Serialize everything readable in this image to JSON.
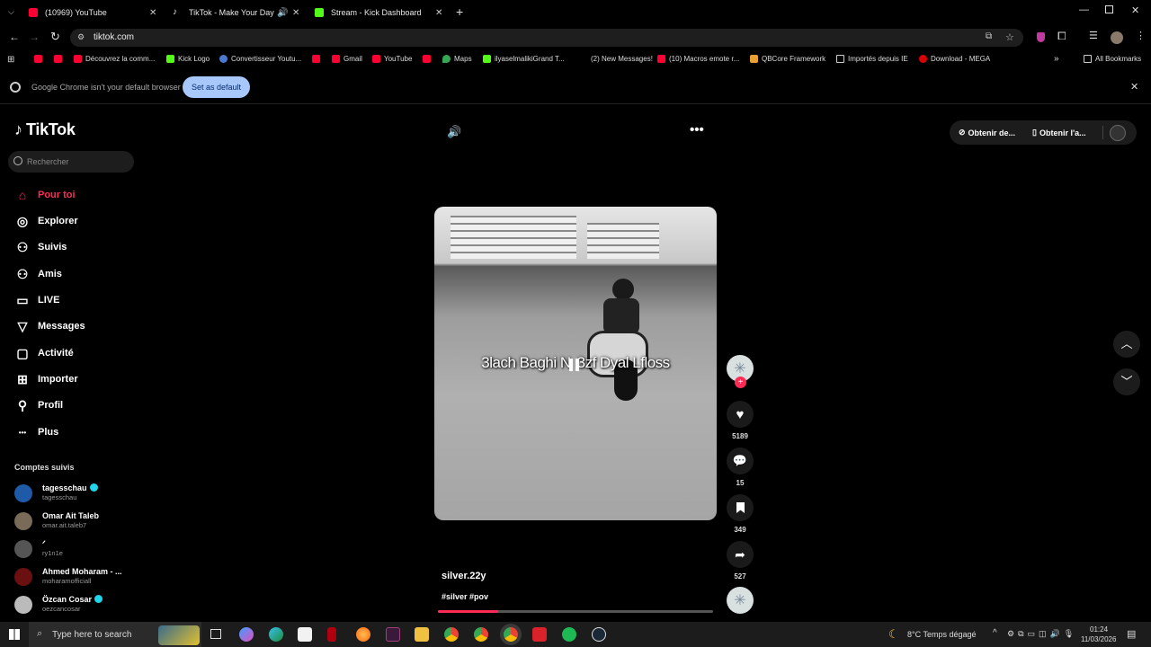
{
  "browser": {
    "tabs": [
      {
        "title": "(10969) YouTube"
      },
      {
        "title": "TikTok - Make Your Day"
      },
      {
        "title": "Stream - Kick Dashboard"
      }
    ],
    "url": "tiktok.com",
    "bookmarks": [
      {
        "label": "Découvrez la comm..."
      },
      {
        "label": "Kick Logo"
      },
      {
        "label": "Convertisseur Youtu..."
      },
      {
        "label": "Gmail"
      },
      {
        "label": "YouTube"
      },
      {
        "label": "Maps"
      },
      {
        "label": "ilyaselmalikiGrand T..."
      },
      {
        "label": "(2) New Messages!"
      },
      {
        "label": "(10) Macros emote r..."
      },
      {
        "label": "QBCore Framework"
      },
      {
        "label": "Importés depuis IE"
      },
      {
        "label": "Download - MEGA"
      }
    ],
    "all_bookmarks": "All Bookmarks",
    "infobar_text": "Google Chrome isn't your default browser",
    "infobar_button": "Set as default"
  },
  "tiktok": {
    "logo": "TikTok",
    "search_placeholder": "Rechercher",
    "nav": [
      {
        "label": "Pour toi",
        "icon": "home-icon",
        "active": true
      },
      {
        "label": "Explorer",
        "icon": "compass-icon"
      },
      {
        "label": "Suivis",
        "icon": "following-icon"
      },
      {
        "label": "Amis",
        "icon": "friends-icon"
      },
      {
        "label": "LIVE",
        "icon": "live-icon"
      },
      {
        "label": "Messages",
        "icon": "messages-icon"
      },
      {
        "label": "Activité",
        "icon": "activity-icon"
      },
      {
        "label": "Importer",
        "icon": "upload-icon"
      },
      {
        "label": "Profil",
        "icon": "profile-icon"
      },
      {
        "label": "Plus",
        "icon": "more-icon"
      }
    ],
    "following_title": "Comptes suivis",
    "following": [
      {
        "name": "tagesschau",
        "handle": "tagesschau",
        "verified": true,
        "color": "#1e5aa8"
      },
      {
        "name": "Omar Ait Taleb",
        "handle": "omar.ait.taleb7",
        "verified": false,
        "color": "#7a6a58"
      },
      {
        "name": "ᐟ",
        "handle": "ry1n1e",
        "verified": false,
        "color": "#555"
      },
      {
        "name": "Ahmed Moharam - ...",
        "handle": "moharamofficiall",
        "verified": false,
        "color": "#6a1010"
      },
      {
        "name": "Özcan Cosar",
        "handle": "oezcancosar",
        "verified": true,
        "color": "#bbb"
      }
    ],
    "top_buttons": {
      "get_desktop": "Obtenir de...",
      "get_app": "Obtenir l'a..."
    },
    "video": {
      "caption": "3lach Baghi N   3zf Dyal Lfloss",
      "author": "silver.22y",
      "hashtags": "#silver #pov",
      "progress": 0.22
    },
    "actions": {
      "likes": "5189",
      "comments": "15",
      "saves": "349",
      "shares": "527"
    }
  },
  "taskbar": {
    "search_placeholder": "Type here to search",
    "weather": "8°C  Temps dégagé",
    "time": "01:24",
    "date": "11/03/2026"
  },
  "colors": {
    "accent": "#fe2c55",
    "infobar_button": "#a8c7fa"
  }
}
